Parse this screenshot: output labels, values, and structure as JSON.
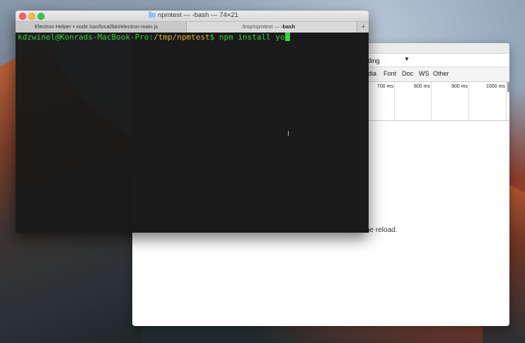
{
  "terminal": {
    "window_title": "npmtest — -bash — 74×21",
    "tabs": [
      {
        "label": "Electron Helper • node /usr/local/bin/electron main.js"
      },
      {
        "label_path": "/tmp/npmtest — ",
        "label_bold": "-bash"
      }
    ],
    "add_tab": "+",
    "prompt_user": "kdzwinel@Konrads-MacBook-Pro",
    "prompt_sep": ":",
    "prompt_path": "/tmp/npmtest",
    "prompt_symbol": "$ ",
    "command": "npm install yo",
    "cursor_glyph": "I"
  },
  "devtools": {
    "throttling_label": "tling",
    "throttling_arrow": "▼",
    "filters": [
      "dia",
      "Font",
      "Doc",
      "WS",
      "Other"
    ],
    "timeline_ticks": [
      "700 ms",
      "800 ms",
      "900 ms",
      "1000 ms"
    ],
    "message": "he reload."
  },
  "colors": {
    "prompt_green": "#39d03a",
    "path_yellow": "#e2b13b",
    "terminal_bg": "#181818"
  }
}
